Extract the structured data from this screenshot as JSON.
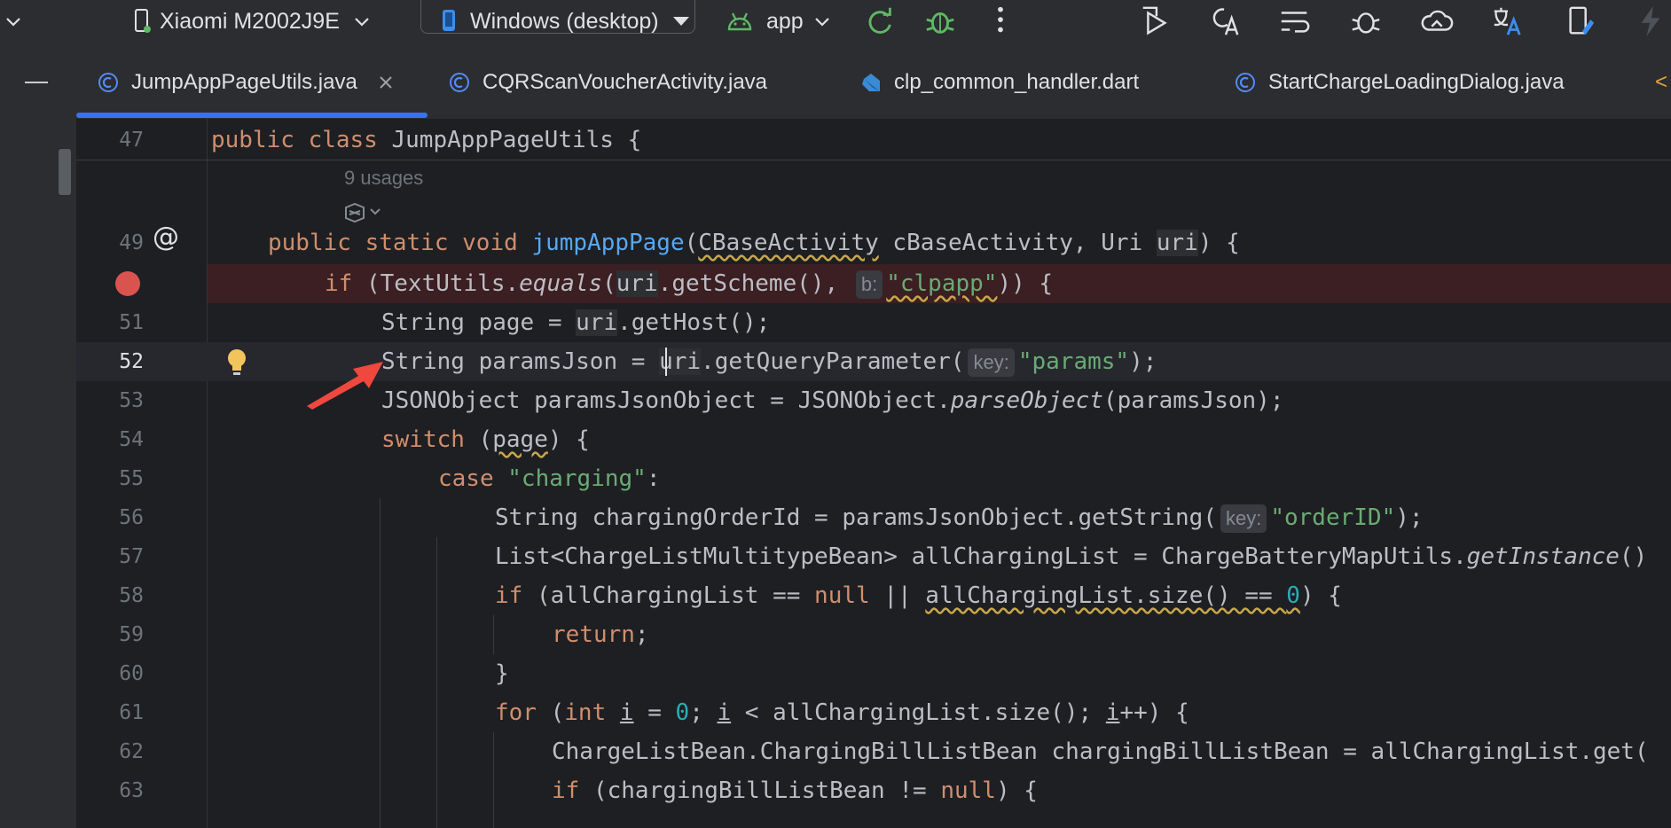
{
  "toolbar": {
    "device": "Xiaomi M2002J9E",
    "target": "Windows (desktop)",
    "module": "app"
  },
  "tabs": [
    {
      "label": "JumpAppPageUtils.java",
      "icon": "java-class-icon",
      "active": true
    },
    {
      "label": "CQRScanVoucherActivity.java",
      "icon": "java-class-icon",
      "active": false
    },
    {
      "label": "clp_common_handler.dart",
      "icon": "dart-file-icon",
      "active": false
    },
    {
      "label": "StartChargeLoadingDialog.java",
      "icon": "java-class-icon",
      "active": false
    }
  ],
  "editor": {
    "usages": "9 usages",
    "lines": [
      {
        "num": "47"
      },
      {
        "num": "49"
      },
      {
        "num": ""
      },
      {
        "num": "51"
      },
      {
        "num": "52"
      },
      {
        "num": "53"
      },
      {
        "num": "54"
      },
      {
        "num": "55"
      },
      {
        "num": "56"
      },
      {
        "num": "57"
      },
      {
        "num": "58"
      },
      {
        "num": "59"
      },
      {
        "num": "60"
      },
      {
        "num": "61"
      },
      {
        "num": "62"
      },
      {
        "num": "63"
      }
    ],
    "code": {
      "l47": [
        "public class",
        " JumpAppPageUtils {"
      ],
      "l49": [
        "public static void",
        "jumpAppPage",
        "(",
        "CBaseActivity",
        " cBaseActivity, Uri ",
        "uri",
        ") {"
      ],
      "l50": [
        "if",
        " (TextUtils.",
        "equals",
        "(",
        "uri",
        ".getScheme(), ",
        "b:",
        "\"clpapp\"",
        ")) {"
      ],
      "l51": [
        "String page = ",
        "uri",
        ".getHost();"
      ],
      "l52": [
        "String paramsJson = ",
        "uri",
        ".getQueryParameter(",
        "key:",
        "\"params\"",
        ");"
      ],
      "l53": [
        "JSONObject paramsJsonObject = JSONObject.",
        "parseObject",
        "(paramsJson);"
      ],
      "l54": [
        "switch",
        " (",
        "page",
        ") {"
      ],
      "l55": [
        "case",
        " ",
        "\"charging\"",
        ":"
      ],
      "l56": [
        "String chargingOrderId = paramsJsonObject.getString(",
        "key:",
        "\"orderID\"",
        ");"
      ],
      "l57": [
        "List<ChargeListMultitypeBean> allChargingList = ChargeBatteryMapUtils.",
        "getInstance",
        "()"
      ],
      "l58": [
        "if",
        " (allChargingList == ",
        "null",
        " || ",
        "allChargingList.size() == ",
        "0",
        ") {"
      ],
      "l59": [
        "return",
        ";"
      ],
      "l60": [
        "}"
      ],
      "l61": [
        "for",
        " (",
        "int",
        " ",
        "i",
        " = ",
        "0",
        "; ",
        "i",
        " < allChargingList.size(); ",
        "i",
        "++) {"
      ],
      "l62": [
        "ChargeListBean.ChargingBillListBean chargingBillListBean = allChargingList.get("
      ],
      "l63": [
        "if",
        " (chargingBillListBean != ",
        "null",
        ") {"
      ]
    }
  }
}
